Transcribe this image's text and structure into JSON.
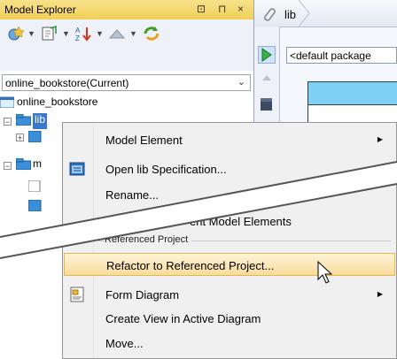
{
  "explorer": {
    "title": "Model Explorer",
    "controls": {
      "pin": "⊡",
      "dock": "⊓",
      "close": "×"
    },
    "project_select": {
      "value": "online_bookstore(Current)"
    },
    "tree": {
      "root_label": "online_bookstore",
      "lib_label": "lib",
      "model_label": "m"
    }
  },
  "diagram": {
    "breadcrumb": "lib",
    "package_field": "<default package"
  },
  "menu": {
    "items": [
      {
        "label": "Model Element",
        "submenu": true
      },
      {
        "label": "Open lib Specification..."
      },
      {
        "label": "Rename..."
      },
      {
        "label": "Select Parent Model Elements",
        "partial": "ent Model Elements"
      }
    ],
    "section": "Referenced Project",
    "items2": [
      {
        "label": "Refactor to Referenced Project...",
        "highlighted": true
      },
      {
        "label": "Form Diagram",
        "submenu": true
      },
      {
        "label": "Create View in Active Diagram"
      },
      {
        "label": "Move..."
      }
    ]
  },
  "colors": {
    "title_bar": "#f1cf57",
    "highlight": "#f9dc9c",
    "class_header": "#7fd0f2"
  },
  "icons": [
    "new-diagram-icon",
    "export-icon",
    "sort-icon",
    "up-icon",
    "refresh-icon",
    "open-spec-icon",
    "form-diagram-icon",
    "mouse-cursor-icon"
  ]
}
